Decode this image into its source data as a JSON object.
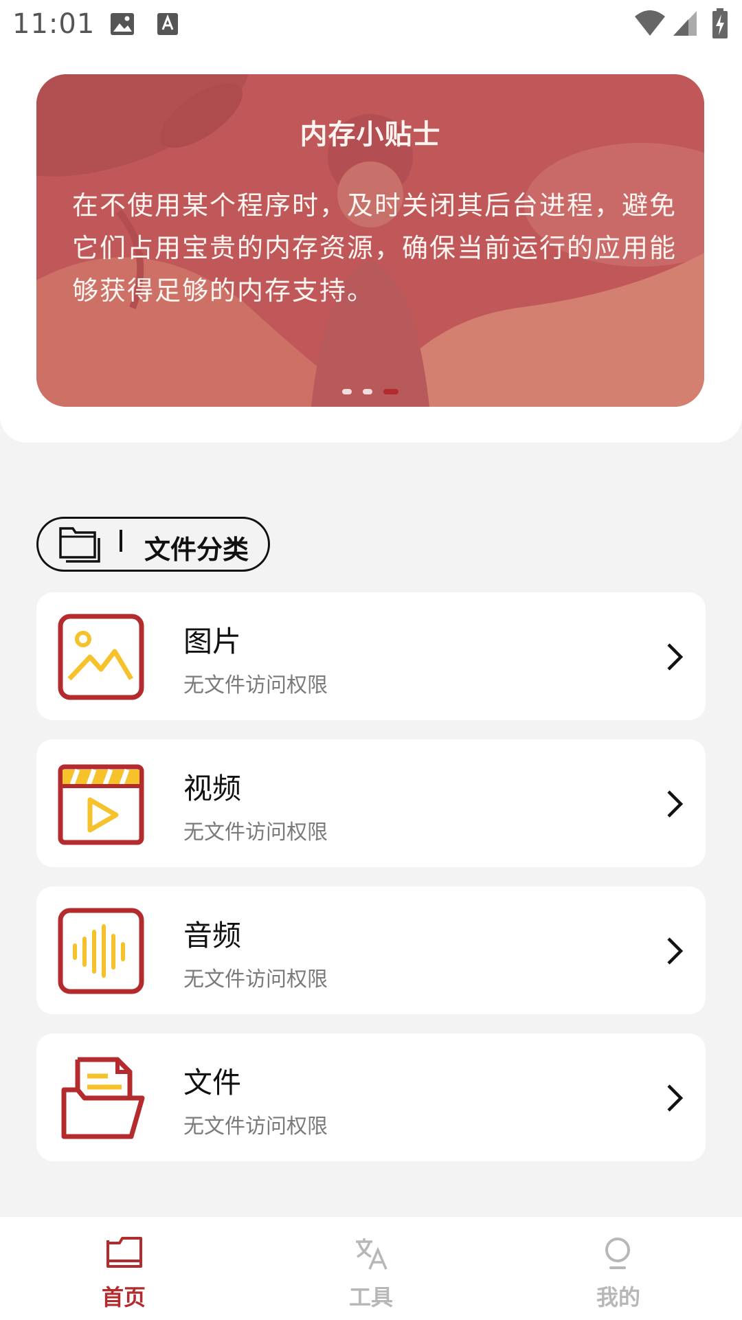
{
  "status_bar": {
    "time": "11:01"
  },
  "banner": {
    "title": "内存小贴士",
    "text": "在不使用某个程序时，及时关闭其后台进程，避免它们占用宝贵的内存资源，确保当前运行的应用能够获得足够的内存支持。",
    "page_count": 3,
    "active_page": 3
  },
  "category_header": {
    "label": "文件分类",
    "separator": "|"
  },
  "categories": [
    {
      "title": "图片",
      "subtitle": "无文件访问权限",
      "icon": "image-icon"
    },
    {
      "title": "视频",
      "subtitle": "无文件访问权限",
      "icon": "video-icon"
    },
    {
      "title": "音频",
      "subtitle": "无文件访问权限",
      "icon": "audio-icon"
    },
    {
      "title": "文件",
      "subtitle": "无文件访问权限",
      "icon": "document-icon"
    }
  ],
  "bottom_nav": [
    {
      "label": "首页",
      "icon": "folder-icon",
      "active": true
    },
    {
      "label": "工具",
      "icon": "translate-icon",
      "active": false
    },
    {
      "label": "我的",
      "icon": "lightbulb-icon",
      "active": false
    }
  ],
  "colors": {
    "accent": "#b42b2e",
    "icon_yellow": "#f6c22b",
    "banner": "#c0585a",
    "inactive": "#b7b7b7"
  }
}
